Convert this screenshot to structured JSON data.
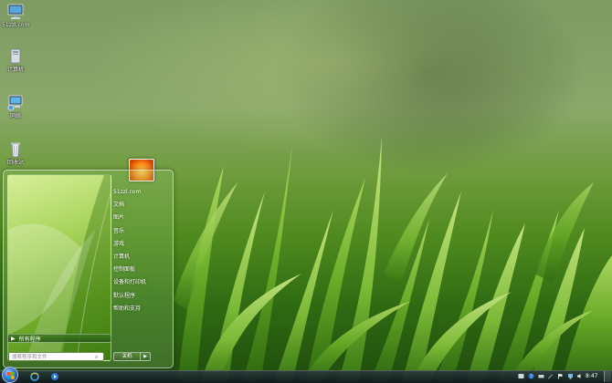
{
  "desktop": {
    "icons": [
      {
        "label": "51zzl.com",
        "icon": "monitor-icon"
      },
      {
        "label": "计算机",
        "icon": "computer-icon"
      },
      {
        "label": "网络",
        "icon": "network-icon"
      },
      {
        "label": "回收站",
        "icon": "recycle-bin-icon"
      }
    ]
  },
  "start_menu": {
    "right_items": [
      "51zzl.com",
      "文档",
      "图片",
      "音乐",
      "游戏",
      "计算机",
      "控制面板",
      "设备和打印机",
      "默认程序",
      "帮助和支持"
    ],
    "all_programs": "所有程序",
    "all_programs_arrow": "▶",
    "search_placeholder": "搜索程序和文件",
    "search_icon": "⌕",
    "shutdown_label": "关机",
    "shutdown_arrow": "▶"
  },
  "taskbar": {
    "clock": "8:47"
  }
}
